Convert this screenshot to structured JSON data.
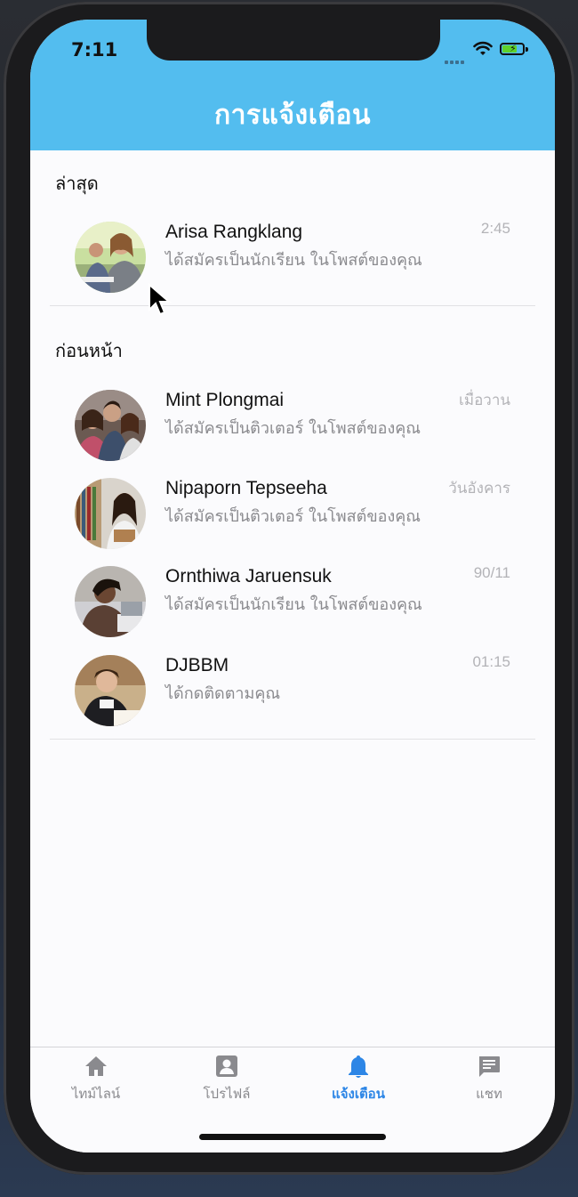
{
  "status_bar": {
    "time": "7:11"
  },
  "header": {
    "title": "การแจ้งเตือน"
  },
  "sections": [
    {
      "title": "ล่าสุด",
      "items": [
        {
          "name": "Arisa Rangklang",
          "message": "ได้สมัครเป็นนักเรียน ในโพสต์ของคุณ",
          "time": "2:45"
        }
      ]
    },
    {
      "title": "ก่อนหน้า",
      "items": [
        {
          "name": "Mint Plongmai",
          "message": "ได้สมัครเป็นติวเตอร์ ในโพสต์ของคุณ",
          "time": "เมื่อวาน"
        },
        {
          "name": "Nipaporn Tepseeha",
          "message": "ได้สมัครเป็นติวเตอร์ ในโพสต์ของคุณ",
          "time": "วันอังคาร"
        },
        {
          "name": "Ornthiwa Jaruensuk",
          "message": "ได้สมัครเป็นนักเรียน ในโพสต์ของคุณ",
          "time": "90/11"
        },
        {
          "name": "DJBBM",
          "message": "ได้กดติดตามคุณ",
          "time": "01:15"
        }
      ]
    }
  ],
  "tabbar": {
    "tabs": [
      {
        "label": "ไทม์ไลน์",
        "icon": "home-icon"
      },
      {
        "label": "โปรไฟล์",
        "icon": "profile-icon"
      },
      {
        "label": "แจ้งเตือน",
        "icon": "bell-icon",
        "active": true
      },
      {
        "label": "แชท",
        "icon": "chat-icon"
      }
    ]
  },
  "colors": {
    "header": "#53bdef",
    "active_tab": "#2d86e6",
    "inactive_tab": "#8a8a8e"
  }
}
